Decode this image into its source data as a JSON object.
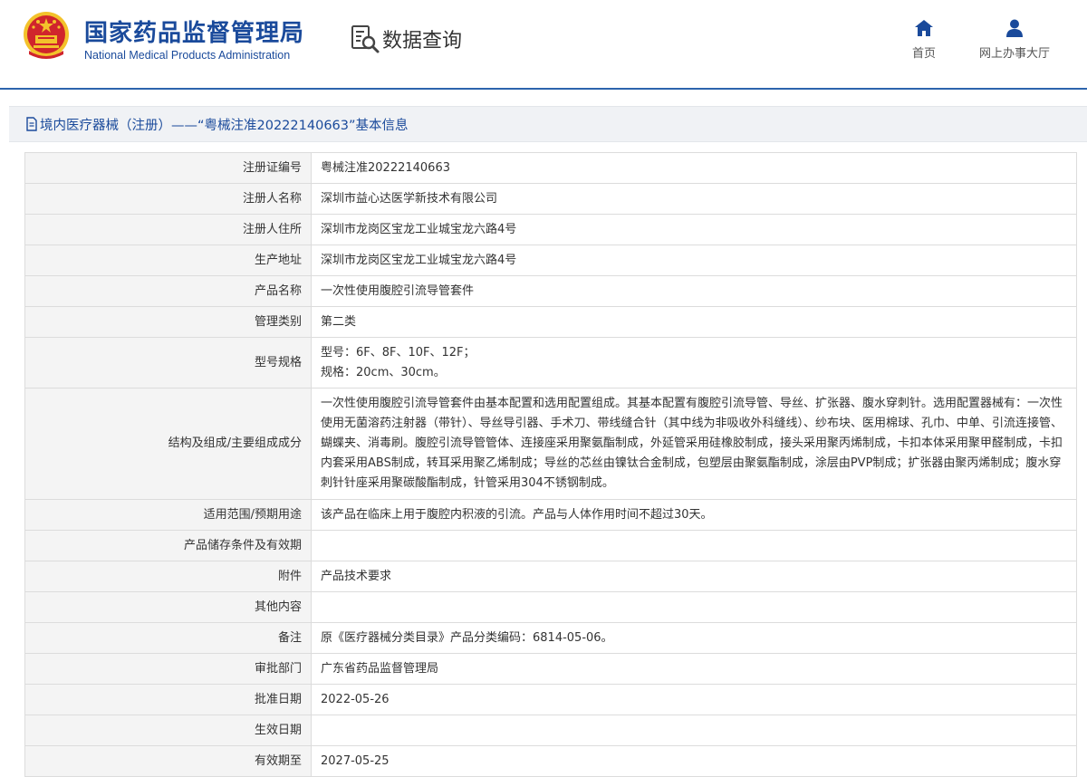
{
  "header": {
    "title_cn": "国家药品监督管理局",
    "title_en": "National Medical Products Administration",
    "query_label": "数据查询",
    "nav": [
      {
        "label": "首页",
        "icon": "home-icon"
      },
      {
        "label": "网上办事大厅",
        "icon": "user-icon"
      }
    ]
  },
  "colors": {
    "brand_blue": "#1a4a9b",
    "rule_blue": "#2d64ad",
    "emblem_red": "#d0252c",
    "emblem_gold": "#f3c22b"
  },
  "breadcrumb": {
    "text": "境内医疗器械（注册）——“粤械注准20222140663”基本信息"
  },
  "rows": [
    {
      "label": "注册证编号",
      "value": "粤械注准20222140663"
    },
    {
      "label": "注册人名称",
      "value": "深圳市益心达医学新技术有限公司"
    },
    {
      "label": "注册人住所",
      "value": "深圳市龙岗区宝龙工业城宝龙六路4号"
    },
    {
      "label": "生产地址",
      "value": "深圳市龙岗区宝龙工业城宝龙六路4号"
    },
    {
      "label": "产品名称",
      "value": "一次性使用腹腔引流导管套件"
    },
    {
      "label": "管理类别",
      "value": "第二类"
    },
    {
      "label": "型号规格",
      "value_lines": [
        "型号：6F、8F、10F、12F；",
        "规格：20cm、30cm。"
      ]
    },
    {
      "label": "结构及组成/主要组成成分",
      "value": "一次性使用腹腔引流导管套件由基本配置和选用配置组成。其基本配置有腹腔引流导管、导丝、扩张器、腹水穿刺针。选用配置器械有：一次性使用无菌溶药注射器（带针）、导丝导引器、手术刀、带线缝合针（其中线为非吸收外科缝线）、纱布块、医用棉球、孔巾、中单、引流连接管、蝴蝶夹、消毒刷。腹腔引流导管管体、连接座采用聚氨酯制成，外延管采用硅橡胶制成，接头采用聚丙烯制成，卡扣本体采用聚甲醛制成，卡扣内套采用ABS制成，转耳采用聚乙烯制成；导丝的芯丝由镍钛合金制成，包塑层由聚氨酯制成，涂层由PVP制成；扩张器由聚丙烯制成；腹水穿刺针针座采用聚碳酸酯制成，针管采用304不锈钢制成。"
    },
    {
      "label": "适用范围/预期用途",
      "value": "该产品在临床上用于腹腔内积液的引流。产品与人体作用时间不超过30天。"
    },
    {
      "label": "产品储存条件及有效期",
      "value": ""
    },
    {
      "label": "附件",
      "value": "产品技术要求"
    },
    {
      "label": "其他内容",
      "value": ""
    },
    {
      "label": "备注",
      "value": "原《医疗器械分类目录》产品分类编码：6814-05-06。"
    },
    {
      "label": "审批部门",
      "value": "广东省药品监督管理局"
    },
    {
      "label": "批准日期",
      "value": "2022-05-26"
    },
    {
      "label": "生效日期",
      "value": ""
    },
    {
      "label": "有效期至",
      "value": "2027-05-25"
    }
  ]
}
